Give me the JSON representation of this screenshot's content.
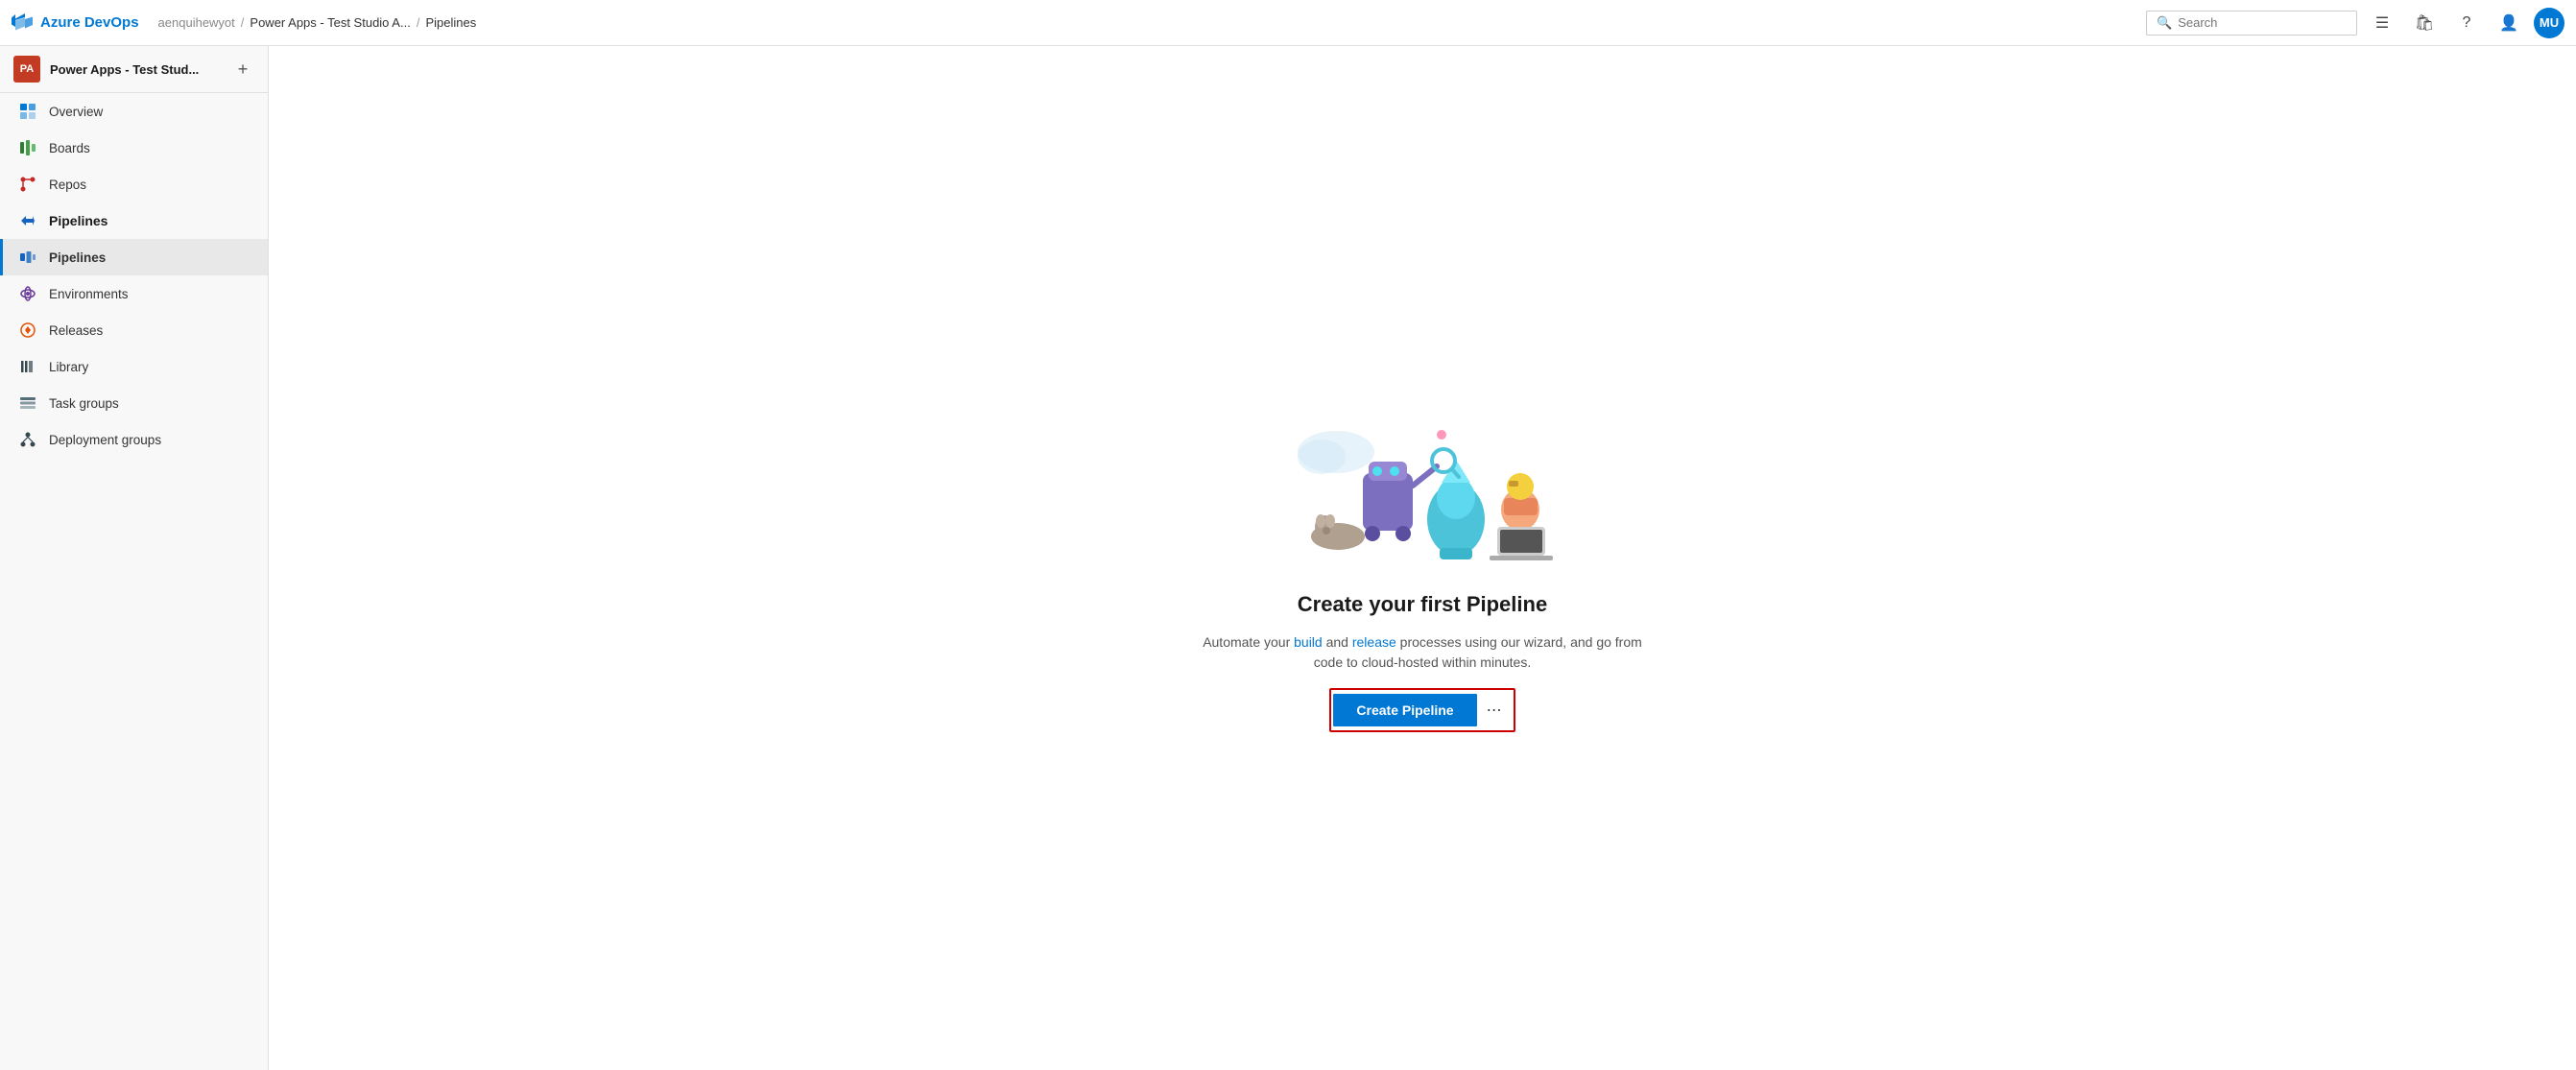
{
  "brand": {
    "name": "Azure DevOps"
  },
  "breadcrumb": {
    "org": "aenquihewyot",
    "sep1": "/",
    "project": "Power Apps - Test Studio A...",
    "sep2": "/",
    "current": "Pipelines"
  },
  "search": {
    "placeholder": "Search"
  },
  "topnav": {
    "list_icon": "≡",
    "bag_icon": "🛍",
    "help_icon": "?",
    "user_icon": "👤",
    "avatar_initials": "MU"
  },
  "project": {
    "initials": "PA",
    "name": "Power Apps - Test Stud...",
    "add_label": "+"
  },
  "sidebar": {
    "items": [
      {
        "id": "overview",
        "label": "Overview",
        "icon": "overview"
      },
      {
        "id": "boards",
        "label": "Boards",
        "icon": "boards"
      },
      {
        "id": "repos",
        "label": "Repos",
        "icon": "repos"
      },
      {
        "id": "pipelines-header",
        "label": "Pipelines",
        "icon": "pipelines",
        "isHeader": true
      },
      {
        "id": "pipelines",
        "label": "Pipelines",
        "icon": "pipelines-sub",
        "isActive": true
      },
      {
        "id": "environments",
        "label": "Environments",
        "icon": "environments"
      },
      {
        "id": "releases",
        "label": "Releases",
        "icon": "releases"
      },
      {
        "id": "library",
        "label": "Library",
        "icon": "library"
      },
      {
        "id": "task-groups",
        "label": "Task groups",
        "icon": "taskgroups"
      },
      {
        "id": "deployment-groups",
        "label": "Deployment groups",
        "icon": "deployment"
      }
    ]
  },
  "empty_state": {
    "title": "Create your first Pipeline",
    "description": "Automate your build and release processes using our wizard, and go from\ncode to cloud-hosted within minutes.",
    "create_btn_label": "Create Pipeline",
    "more_options": "⋯"
  }
}
